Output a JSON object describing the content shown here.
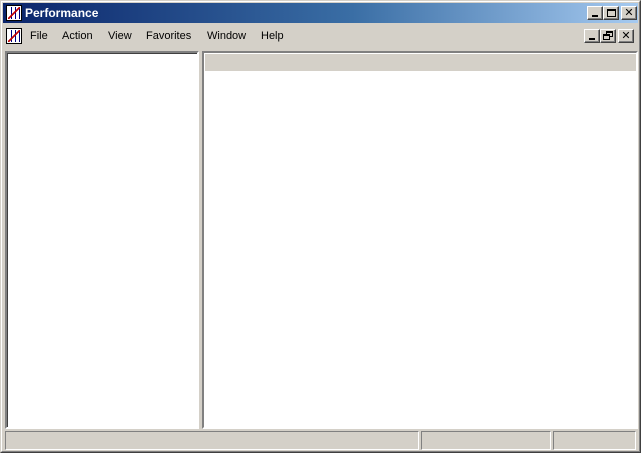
{
  "window": {
    "title": "Performance"
  },
  "menubar": {
    "items": [
      {
        "label": "File"
      },
      {
        "label": "Action"
      },
      {
        "label": "View"
      },
      {
        "label": "Favorites"
      },
      {
        "label": "Window"
      },
      {
        "label": "Help"
      }
    ]
  },
  "icons": {
    "app": "performance-chart-icon",
    "window_controls": [
      "minimize-icon",
      "maximize-icon",
      "close-icon"
    ],
    "child_controls": [
      "minimize-icon",
      "restore-icon",
      "close-icon"
    ]
  },
  "statusbar": {
    "panels": [
      "",
      "",
      ""
    ]
  },
  "colors": {
    "title_gradient_start": "#0a246a",
    "title_gradient_end": "#a6caf0",
    "face": "#d4d0c8",
    "pane": "#ffffff"
  }
}
